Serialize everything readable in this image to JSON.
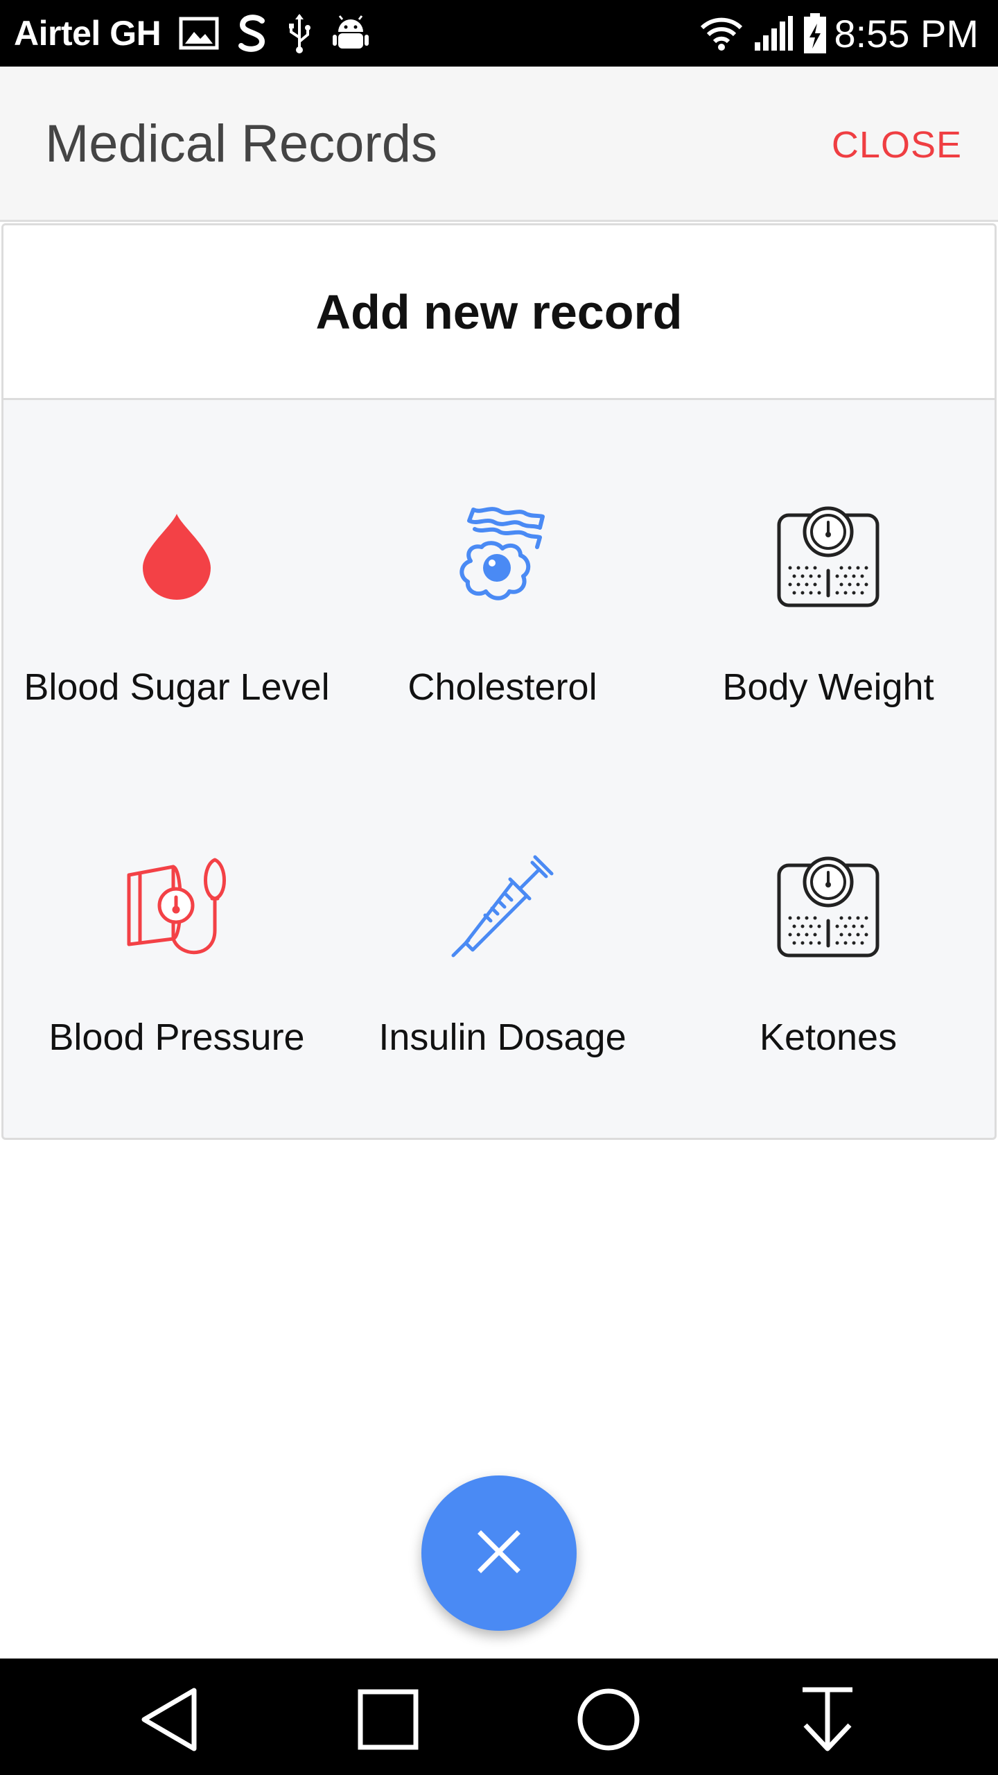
{
  "status_bar": {
    "carrier": "Airtel GH",
    "time": "8:55 PM",
    "left_icons": [
      "image-icon",
      "s-app-icon",
      "usb-icon",
      "android-debug-icon"
    ],
    "right_icons": [
      "wifi-icon",
      "signal-icon",
      "battery-charging-icon"
    ]
  },
  "header": {
    "title": "Medical Records",
    "close_label": "CLOSE"
  },
  "card": {
    "title": "Add new record",
    "items": [
      {
        "label": "Blood Sugar Level",
        "icon": "blood-drop-icon",
        "color": "#f34146"
      },
      {
        "label": "Cholesterol",
        "icon": "bacon-egg-icon",
        "color": "#4a8af4"
      },
      {
        "label": "Body Weight",
        "icon": "weighing-scale-icon",
        "color": "#222222"
      },
      {
        "label": "Blood Pressure",
        "icon": "blood-pressure-cuff-icon",
        "color": "#f34146"
      },
      {
        "label": "Insulin Dosage",
        "icon": "syringe-icon",
        "color": "#4a8af4"
      },
      {
        "label": "Ketones",
        "icon": "weighing-scale-icon",
        "color": "#222222"
      }
    ]
  },
  "fab": {
    "icon": "close-icon",
    "color": "#4a8af4"
  },
  "nav_bar": {
    "buttons": [
      "back-icon",
      "recents-icon",
      "home-icon",
      "hide-keyboard-icon"
    ]
  },
  "colors": {
    "accent_red": "#ef3e42",
    "accent_blue": "#4a8af4",
    "header_bg": "#f6f6f6",
    "card_bg": "#f6f7f9"
  }
}
